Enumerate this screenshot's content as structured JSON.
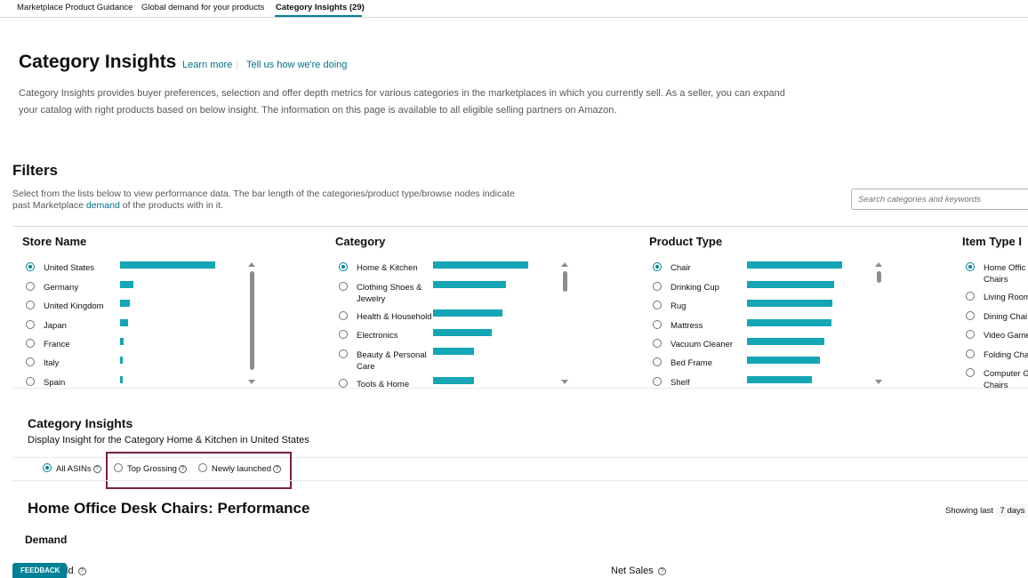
{
  "tabs": [
    {
      "label": "Marketplace Product Guidance"
    },
    {
      "label": "Global demand for your products"
    },
    {
      "label": "Category Insights (29)"
    }
  ],
  "page": {
    "title": "Category Insights",
    "learn_more": "Learn more",
    "feedback_link": "Tell us how we're doing",
    "intro": "Category Insights provides buyer preferences, selection and offer depth metrics for various categories in the marketplaces in which you currently sell. As a seller, you can expand your catalog with right products based on below insight. The information on this page is available to all eligible selling partners on Amazon."
  },
  "filters": {
    "title": "Filters",
    "desc_before": "Select from the lists below to view performance data. The bar length of the categories/product type/browse nodes indicate past Marketplace ",
    "desc_link": "demand",
    "desc_after": " of the products with in it.",
    "search_placeholder": "Search categories and keywords",
    "columns": [
      {
        "title": "Store Name",
        "items": [
          {
            "label": "United States",
            "demand": 1.0,
            "checked": true
          },
          {
            "label": "Germany",
            "demand": 0.14
          },
          {
            "label": "United Kingdom",
            "demand": 0.1
          },
          {
            "label": "Japan",
            "demand": 0.08
          },
          {
            "label": "France",
            "demand": 0.04
          },
          {
            "label": "Italy",
            "demand": 0.03
          },
          {
            "label": "Spain",
            "demand": 0.02
          }
        ]
      },
      {
        "title": "Category",
        "items": [
          {
            "label": "Home & Kitchen",
            "demand": 1.0,
            "checked": true
          },
          {
            "label": "Clothing Shoes & Jewelry",
            "demand": 0.77
          },
          {
            "label": "Health & Household",
            "demand": 0.73
          },
          {
            "label": "Electronics",
            "demand": 0.62
          },
          {
            "label": "Beauty & Personal Care",
            "demand": 0.43
          },
          {
            "label": "Tools & Home",
            "demand": 0.43
          }
        ]
      },
      {
        "title": "Product Type",
        "items": [
          {
            "label": "Chair",
            "demand": 1.0,
            "checked": true
          },
          {
            "label": "Drinking Cup",
            "demand": 0.92
          },
          {
            "label": "Rug",
            "demand": 0.9
          },
          {
            "label": "Mattress",
            "demand": 0.89
          },
          {
            "label": "Vacuum Cleaner",
            "demand": 0.81
          },
          {
            "label": "Bed Frame",
            "demand": 0.77
          },
          {
            "label": "Shelf",
            "demand": 0.68
          }
        ]
      },
      {
        "title": "Item Type I",
        "items": [
          {
            "label": "Home Offic Chairs",
            "checked": true
          },
          {
            "label": "Living Room"
          },
          {
            "label": "Dining Chai"
          },
          {
            "label": "Video Game"
          },
          {
            "label": "Folding Cha"
          },
          {
            "label": "Computer G Chairs"
          }
        ]
      }
    ]
  },
  "insights": {
    "title": "Category Insights",
    "subtitle": "Display Insight for the Category Home & Kitchen in United States",
    "options": [
      {
        "label": "All ASINs",
        "checked": true
      },
      {
        "label": "Top Grossing"
      },
      {
        "label": "Newly launched"
      }
    ]
  },
  "performance": {
    "title": "Home Office Desk Chairs: Performance",
    "showing_label": "Showing last",
    "days": "7 days",
    "demand_heading": "Demand",
    "sold_label": "ld",
    "net_sales": "Net Sales",
    "feedback_button": "FEEDBACK"
  },
  "icons": {
    "help": "question-circle-icon",
    "close": "close-icon",
    "sort": "chevron-up-down-icon"
  },
  "colors": {
    "accent": "#008296",
    "bar": "#14a6b4",
    "link": "#007185",
    "highlight": "#7d1e3c"
  }
}
